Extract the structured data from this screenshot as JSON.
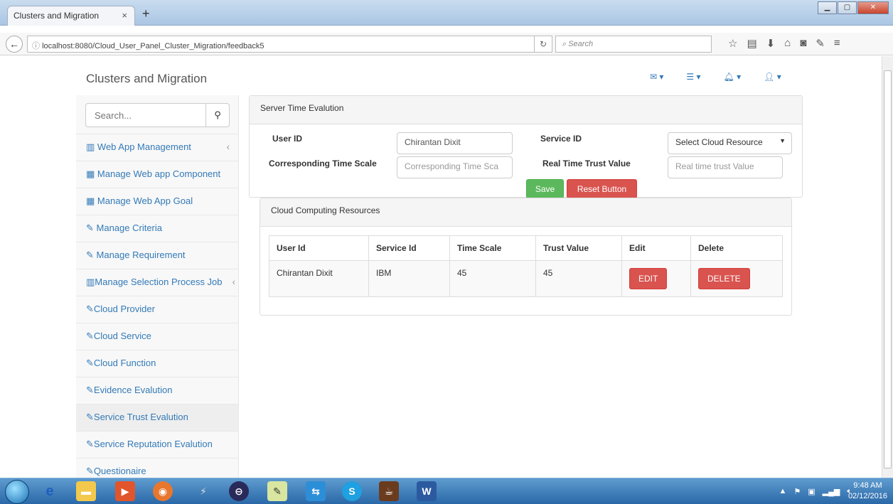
{
  "browser": {
    "tab_title": "Clusters and Migration",
    "tab_close": "×",
    "new_tab": "+",
    "url": "localhost:8080/Cloud_User_Panel_Cluster_Migration/feedback5",
    "search_placeholder": "Search"
  },
  "header": {
    "brand": "Clusters and Migration",
    "nav_icons": [
      "envelope-icon",
      "tasks-icon",
      "bell-icon",
      "user-icon"
    ]
  },
  "sidebar": {
    "search_placeholder": "Search...",
    "items": [
      {
        "label": "Web App Management",
        "icon": "bar-chart-icon",
        "has_arrow": true
      },
      {
        "label": "Manage Web app Component",
        "icon": "table-icon"
      },
      {
        "label": "Manage Web App Goal",
        "icon": "table-icon"
      },
      {
        "label": "Manage Criteria",
        "icon": "edit-icon"
      },
      {
        "label": "Manage Requirement",
        "icon": "edit-icon"
      },
      {
        "label": "Manage Selection Process Job",
        "icon": "bar-chart-icon",
        "has_arrow": true
      },
      {
        "label": "Cloud Provider",
        "icon": "edit-icon"
      },
      {
        "label": "Cloud Service",
        "icon": "edit-icon"
      },
      {
        "label": "Cloud Function",
        "icon": "edit-icon"
      },
      {
        "label": "Evidence Evalution",
        "icon": "edit-icon"
      },
      {
        "label": "Service Trust Evalution",
        "icon": "edit-icon",
        "active": true
      },
      {
        "label": "Service Reputation Evalution",
        "icon": "edit-icon"
      },
      {
        "label": "Questionaire",
        "icon": "edit-icon"
      }
    ]
  },
  "form_panel": {
    "heading": "Server Time Evalution",
    "user_id_label": "User ID",
    "user_id_value": "Chirantan Dixit",
    "service_id_label": "Service ID",
    "service_id_select": "Select Cloud Resource",
    "time_scale_label": "Corresponding Time Scale",
    "time_scale_placeholder": "Corresponding Time Sca",
    "trust_label": "Real Time Trust Value",
    "trust_placeholder": "Real time trust Value",
    "save_label": "Save",
    "reset_label": "Reset Button"
  },
  "table_panel": {
    "heading": "Cloud Computing Resources",
    "columns": [
      "User Id",
      "Service Id",
      "Time Scale",
      "Trust Value",
      "Edit",
      "Delete"
    ],
    "rows": [
      {
        "user_id": "Chirantan Dixit",
        "service_id": "IBM",
        "time_scale": "45",
        "trust_value": "45",
        "edit": "EDIT",
        "delete": "DELETE"
      }
    ]
  },
  "taskbar": {
    "time": "9:48 AM",
    "date": "02/12/2016"
  },
  "colors": {
    "link": "#337ab7",
    "success": "#5cb85c",
    "danger": "#d9534f"
  }
}
